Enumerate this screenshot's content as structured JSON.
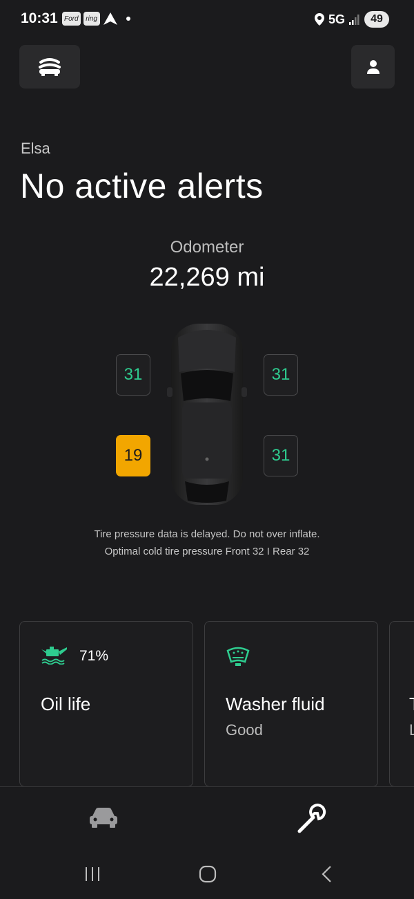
{
  "status_bar": {
    "time": "10:31",
    "notifications": [
      "Ford",
      "ring"
    ],
    "network": "5G",
    "battery": "49"
  },
  "header": {
    "vehicle_name": "Elsa",
    "alert_title": "No active alerts"
  },
  "odometer": {
    "label": "Odometer",
    "value": "22,269 mi"
  },
  "tires": {
    "front_left": "31",
    "front_right": "31",
    "rear_left": "19",
    "rear_right": "31",
    "ok_color": "#2ecc8f",
    "warn_color": "#f2a600"
  },
  "tire_note": {
    "line1": "Tire pressure data is delayed. Do not over inflate.",
    "line2": "Optimal cold tire pressure Front 32 I Rear 32"
  },
  "cards": {
    "oil": {
      "percent": "71%",
      "title": "Oil life",
      "icon": "oil-can-icon"
    },
    "washer": {
      "title": "Washer fluid",
      "status": "Good",
      "icon": "windshield-washer-icon"
    },
    "extra": {
      "title_partial": "T",
      "sub_partial": "L"
    }
  },
  "bottom_nav": {
    "items": [
      {
        "icon": "car-icon",
        "active": false
      },
      {
        "icon": "wrench-icon",
        "active": true
      }
    ]
  },
  "accent_color": "#2ecc8f"
}
